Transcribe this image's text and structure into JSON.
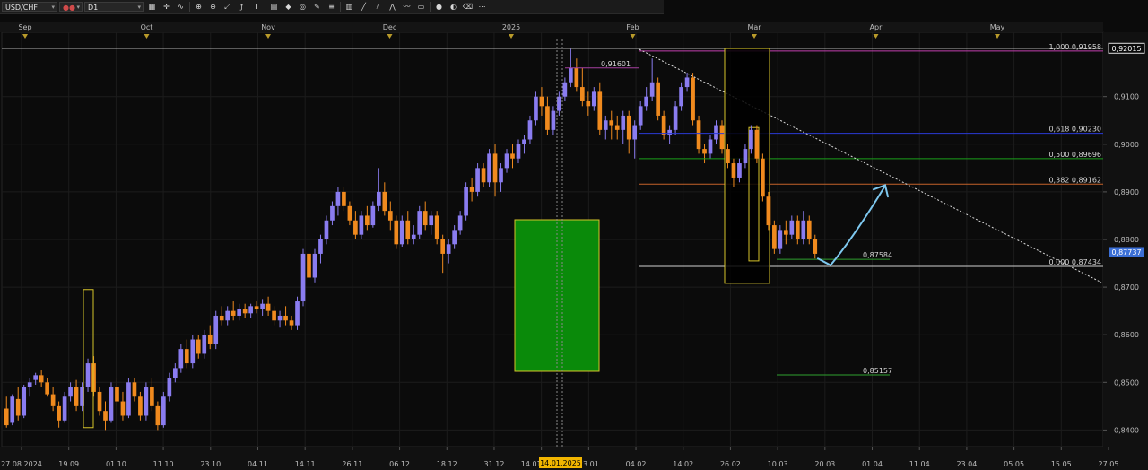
{
  "toolbar": {
    "symbol": "USD/CHF",
    "timeframe": "D1",
    "tool_icons": [
      "chart-type-icon",
      "crosshair-icon",
      "line-chart-icon",
      "zoom-in-icon",
      "zoom-out-icon",
      "zoom-reset-icon",
      "indicator-icon",
      "text-tool-icon",
      "template-icon",
      "color-icon",
      "globe-icon",
      "pencil-icon",
      "fibonacci-icon",
      "table-icon",
      "trendline-icon",
      "channel-icon",
      "pattern-icon",
      "wave-icon",
      "shape-icon",
      "sphere-icon",
      "palette-icon",
      "eraser-icon",
      "more-icon"
    ]
  },
  "colors": {
    "background": "#0b0b0b",
    "grid": "#1c1c1c",
    "bull": "#8a7cf0",
    "bear": "#f08a1e",
    "highlight_box": "#d6c42a",
    "green_zone": "#0a8a0a",
    "fib_100": "#c23fae",
    "fib_618": "#2a3ad6",
    "fib_500": "#1aa01a",
    "fib_382": "#c4632a",
    "fib_0": "#cfcfcf",
    "price_tag": "#3b6fd6",
    "arrow": "#7ec8ef"
  },
  "chart_data": {
    "type": "candlestick",
    "symbol": "USD/CHF",
    "timeframe": "D1",
    "ylim": [
      0.8365,
      0.9235
    ],
    "y_ticks": [
      "0,8400",
      "0,8500",
      "0,8600",
      "0,8700",
      "0,8800",
      "0,8900",
      "0,9000",
      "0,9100"
    ],
    "top_months": [
      "Sep",
      "Oct",
      "Nov",
      "Dec",
      "2025",
      "Feb",
      "Mar",
      "Apr",
      "May"
    ],
    "bottom_dates": [
      "27.08.2024",
      "19.09",
      "01.10",
      "11.10",
      "23.10",
      "04.11",
      "14.11",
      "26.11",
      "06.12",
      "18.12",
      "31.12",
      "14.01.2025",
      "23.01",
      "04.02",
      "14.02",
      "26.02",
      "10.03",
      "20.03",
      "01.04",
      "11.04",
      "23.04",
      "05.05",
      "15.05",
      "27.05"
    ],
    "cursor_date_label": "14.01.2025",
    "current_price_label": "0,87737",
    "current_price": 0.87737,
    "top_price_label": "0,92015",
    "top_price": 0.92015,
    "fib_levels": [
      {
        "label": "1,000 0,91958",
        "price": 0.91958,
        "color": "#c23fae"
      },
      {
        "label": "0,618 0,90230",
        "price": 0.9023,
        "color": "#2a3ad6"
      },
      {
        "label": "0,500 0,89696",
        "price": 0.89696,
        "color": "#1aa01a"
      },
      {
        "label": "0,382 0,89162",
        "price": 0.89162,
        "color": "#c4632a"
      },
      {
        "label": "0,000 0,87434",
        "price": 0.87434,
        "color": "#cfcfcf"
      }
    ],
    "levels": [
      {
        "label": "0,91601",
        "price": 0.91601
      },
      {
        "label": "0,87584",
        "price": 0.87584
      },
      {
        "label": "0,85157",
        "price": 0.85157
      }
    ],
    "candles": [
      [
        0.8445,
        0.847,
        0.8405,
        0.841
      ],
      [
        0.8415,
        0.8475,
        0.841,
        0.847
      ],
      [
        0.8465,
        0.849,
        0.842,
        0.843
      ],
      [
        0.843,
        0.8495,
        0.8425,
        0.849
      ],
      [
        0.849,
        0.851,
        0.847,
        0.85
      ],
      [
        0.8505,
        0.852,
        0.8495,
        0.8515
      ],
      [
        0.8515,
        0.8525,
        0.849,
        0.85
      ],
      [
        0.85,
        0.851,
        0.847,
        0.8475
      ],
      [
        0.8475,
        0.849,
        0.844,
        0.845
      ],
      [
        0.845,
        0.846,
        0.8405,
        0.842
      ],
      [
        0.842,
        0.848,
        0.8415,
        0.847
      ],
      [
        0.847,
        0.85,
        0.846,
        0.849
      ],
      [
        0.849,
        0.8505,
        0.844,
        0.845
      ],
      [
        0.845,
        0.85,
        0.844,
        0.849
      ],
      [
        0.849,
        0.855,
        0.848,
        0.854
      ],
      [
        0.854,
        0.8555,
        0.847,
        0.848
      ],
      [
        0.848,
        0.849,
        0.843,
        0.844
      ],
      [
        0.844,
        0.846,
        0.84,
        0.842
      ],
      [
        0.842,
        0.85,
        0.8415,
        0.849
      ],
      [
        0.849,
        0.851,
        0.845,
        0.846
      ],
      [
        0.846,
        0.848,
        0.842,
        0.843
      ],
      [
        0.843,
        0.851,
        0.8425,
        0.85
      ],
      [
        0.85,
        0.851,
        0.846,
        0.847
      ],
      [
        0.847,
        0.848,
        0.842,
        0.843
      ],
      [
        0.843,
        0.85,
        0.842,
        0.849
      ],
      [
        0.849,
        0.851,
        0.844,
        0.845
      ],
      [
        0.845,
        0.846,
        0.84,
        0.841
      ],
      [
        0.841,
        0.848,
        0.8405,
        0.847
      ],
      [
        0.847,
        0.852,
        0.846,
        0.851
      ],
      [
        0.851,
        0.854,
        0.85,
        0.853
      ],
      [
        0.853,
        0.858,
        0.852,
        0.857
      ],
      [
        0.857,
        0.859,
        0.853,
        0.854
      ],
      [
        0.854,
        0.86,
        0.853,
        0.859
      ],
      [
        0.859,
        0.86,
        0.855,
        0.856
      ],
      [
        0.856,
        0.861,
        0.855,
        0.86
      ],
      [
        0.86,
        0.862,
        0.857,
        0.858
      ],
      [
        0.858,
        0.865,
        0.857,
        0.864
      ],
      [
        0.864,
        0.866,
        0.862,
        0.863
      ],
      [
        0.863,
        0.866,
        0.862,
        0.865
      ],
      [
        0.865,
        0.867,
        0.863,
        0.864
      ],
      [
        0.864,
        0.8665,
        0.863,
        0.8655
      ],
      [
        0.8655,
        0.8665,
        0.8635,
        0.8645
      ],
      [
        0.8645,
        0.8665,
        0.8635,
        0.866
      ],
      [
        0.866,
        0.867,
        0.8645,
        0.8655
      ],
      [
        0.8655,
        0.8675,
        0.864,
        0.8665
      ],
      [
        0.8665,
        0.868,
        0.864,
        0.865
      ],
      [
        0.865,
        0.866,
        0.862,
        0.863
      ],
      [
        0.863,
        0.865,
        0.8615,
        0.864
      ],
      [
        0.864,
        0.866,
        0.862,
        0.863
      ],
      [
        0.863,
        0.864,
        0.861,
        0.862
      ],
      [
        0.862,
        0.868,
        0.861,
        0.867
      ],
      [
        0.867,
        0.878,
        0.866,
        0.877
      ],
      [
        0.877,
        0.879,
        0.871,
        0.872
      ],
      [
        0.872,
        0.878,
        0.871,
        0.877
      ],
      [
        0.877,
        0.881,
        0.875,
        0.88
      ],
      [
        0.88,
        0.885,
        0.879,
        0.884
      ],
      [
        0.884,
        0.888,
        0.883,
        0.887
      ],
      [
        0.887,
        0.891,
        0.885,
        0.89
      ],
      [
        0.89,
        0.891,
        0.886,
        0.887
      ],
      [
        0.887,
        0.888,
        0.883,
        0.884
      ],
      [
        0.884,
        0.886,
        0.88,
        0.881
      ],
      [
        0.881,
        0.886,
        0.88,
        0.885
      ],
      [
        0.885,
        0.887,
        0.882,
        0.883
      ],
      [
        0.883,
        0.888,
        0.8825,
        0.887
      ],
      [
        0.887,
        0.895,
        0.886,
        0.89
      ],
      [
        0.89,
        0.892,
        0.885,
        0.886
      ],
      [
        0.886,
        0.888,
        0.882,
        0.884
      ],
      [
        0.884,
        0.885,
        0.878,
        0.879
      ],
      [
        0.879,
        0.885,
        0.8785,
        0.884
      ],
      [
        0.884,
        0.886,
        0.879,
        0.88
      ],
      [
        0.88,
        0.883,
        0.879,
        0.881
      ],
      [
        0.881,
        0.887,
        0.88,
        0.886
      ],
      [
        0.886,
        0.888,
        0.882,
        0.883
      ],
      [
        0.883,
        0.886,
        0.881,
        0.885
      ],
      [
        0.885,
        0.886,
        0.879,
        0.88
      ],
      [
        0.88,
        0.881,
        0.873,
        0.877
      ],
      [
        0.877,
        0.88,
        0.875,
        0.879
      ],
      [
        0.879,
        0.883,
        0.878,
        0.882
      ],
      [
        0.882,
        0.886,
        0.881,
        0.885
      ],
      [
        0.885,
        0.892,
        0.884,
        0.891
      ],
      [
        0.891,
        0.893,
        0.888,
        0.89
      ],
      [
        0.89,
        0.896,
        0.889,
        0.895
      ],
      [
        0.895,
        0.896,
        0.891,
        0.892
      ],
      [
        0.892,
        0.899,
        0.891,
        0.898
      ],
      [
        0.898,
        0.9,
        0.889,
        0.892
      ],
      [
        0.892,
        0.896,
        0.89,
        0.895
      ],
      [
        0.895,
        0.899,
        0.894,
        0.898
      ],
      [
        0.898,
        0.9,
        0.895,
        0.897
      ],
      [
        0.897,
        0.901,
        0.896,
        0.9
      ],
      [
        0.9,
        0.902,
        0.898,
        0.901
      ],
      [
        0.901,
        0.906,
        0.9,
        0.905
      ],
      [
        0.905,
        0.911,
        0.904,
        0.91
      ],
      [
        0.91,
        0.912,
        0.906,
        0.908
      ],
      [
        0.908,
        0.91,
        0.902,
        0.903
      ],
      [
        0.903,
        0.908,
        0.902,
        0.907
      ],
      [
        0.907,
        0.911,
        0.906,
        0.91
      ],
      [
        0.91,
        0.914,
        0.909,
        0.913
      ],
      [
        0.913,
        0.92,
        0.912,
        0.916
      ],
      [
        0.916,
        0.918,
        0.911,
        0.912
      ],
      [
        0.912,
        0.916,
        0.908,
        0.909
      ],
      [
        0.909,
        0.911,
        0.906,
        0.908
      ],
      [
        0.908,
        0.912,
        0.907,
        0.911
      ],
      [
        0.911,
        0.913,
        0.902,
        0.903
      ],
      [
        0.903,
        0.906,
        0.901,
        0.905
      ],
      [
        0.905,
        0.907,
        0.901,
        0.904
      ],
      [
        0.904,
        0.906,
        0.901,
        0.903
      ],
      [
        0.903,
        0.907,
        0.9,
        0.906
      ],
      [
        0.906,
        0.907,
        0.898,
        0.901
      ],
      [
        0.901,
        0.905,
        0.897,
        0.904
      ],
      [
        0.904,
        0.909,
        0.903,
        0.908
      ],
      [
        0.908,
        0.912,
        0.907,
        0.91
      ],
      [
        0.91,
        0.918,
        0.909,
        0.913
      ],
      [
        0.913,
        0.914,
        0.905,
        0.906
      ],
      [
        0.906,
        0.907,
        0.901,
        0.902
      ],
      [
        0.902,
        0.904,
        0.9,
        0.903
      ],
      [
        0.903,
        0.909,
        0.902,
        0.908
      ],
      [
        0.908,
        0.913,
        0.907,
        0.912
      ],
      [
        0.912,
        0.915,
        0.911,
        0.914
      ],
      [
        0.914,
        0.915,
        0.904,
        0.905
      ],
      [
        0.905,
        0.906,
        0.898,
        0.899
      ],
      [
        0.899,
        0.9,
        0.896,
        0.898
      ],
      [
        0.898,
        0.902,
        0.897,
        0.901
      ],
      [
        0.901,
        0.905,
        0.9,
        0.904
      ],
      [
        0.904,
        0.905,
        0.898,
        0.899
      ],
      [
        0.899,
        0.9,
        0.895,
        0.896
      ],
      [
        0.896,
        0.897,
        0.891,
        0.893
      ],
      [
        0.893,
        0.897,
        0.892,
        0.896
      ],
      [
        0.896,
        0.9,
        0.895,
        0.899
      ],
      [
        0.899,
        0.904,
        0.898,
        0.903
      ],
      [
        0.903,
        0.904,
        0.896,
        0.897
      ],
      [
        0.897,
        0.898,
        0.888,
        0.889
      ],
      [
        0.889,
        0.89,
        0.882,
        0.883
      ],
      [
        0.883,
        0.884,
        0.877,
        0.878
      ],
      [
        0.878,
        0.883,
        0.877,
        0.882
      ],
      [
        0.882,
        0.884,
        0.879,
        0.881
      ],
      [
        0.881,
        0.885,
        0.88,
        0.884
      ],
      [
        0.884,
        0.885,
        0.879,
        0.88
      ],
      [
        0.88,
        0.886,
        0.879,
        0.884
      ],
      [
        0.884,
        0.885,
        0.879,
        0.88
      ],
      [
        0.88,
        0.881,
        0.876,
        0.877
      ]
    ]
  }
}
